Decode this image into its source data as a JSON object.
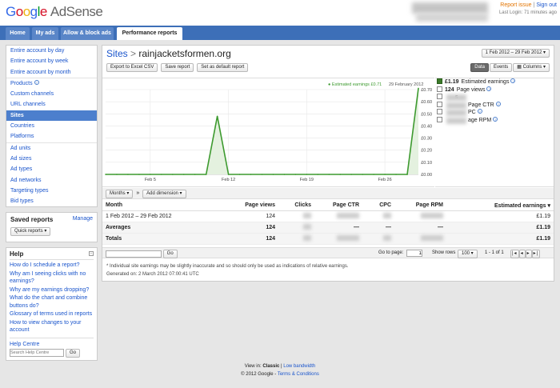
{
  "header": {
    "logo_parts": [
      "G",
      "o",
      "o",
      "g",
      "l",
      "e"
    ],
    "logo_product": "AdSense",
    "report_issue": "Report issue",
    "sign_out": "Sign out",
    "separator": "|",
    "last_login": "Last Login: 71 minutes ago"
  },
  "nav": {
    "tabs": [
      "Home",
      "My ads",
      "Allow & block ads",
      "Performance reports"
    ]
  },
  "sidebar": {
    "groups": [
      [
        "Entire account by day",
        "Entire account by week",
        "Entire account by month"
      ],
      [
        "Products",
        "Custom channels",
        "URL channels",
        "Sites",
        "Countries",
        "Platforms"
      ],
      [
        "Ad units",
        "Ad sizes",
        "Ad types",
        "Ad networks",
        "Targeting types",
        "Bid types"
      ]
    ],
    "selected": "Sites",
    "saved_title": "Saved reports",
    "manage": "Manage",
    "quick_reports": "Quick reports ▾",
    "help_title": "Help",
    "help_toggle": "−",
    "help_links": [
      "How do I schedule a report?",
      "Why am I seeing clicks with no earnings?",
      "Why are my earnings dropping?",
      "What do the chart and combine buttons do?",
      "Glossary of terms used in reports",
      "How to view changes to your account"
    ],
    "help_centre": "Help Centre",
    "help_search_placeholder": "Search Help Centre",
    "go": "Go"
  },
  "report": {
    "crumb": "Sites",
    "crumb_sep": ">",
    "site": "rainjacketsformen.org",
    "date_range": "1 Feb 2012 – 29 Feb 2012 ▾",
    "actions": [
      "Export to Excel CSV",
      "Save report",
      "Set as default report"
    ],
    "views": [
      "Data",
      "Events",
      "▦ Columns ▾"
    ],
    "tooltip_label": "● Estimated earnings £0.71",
    "tooltip_date": "29 February 2012",
    "metrics": [
      {
        "value": "£1.19",
        "label": "Estimated earnings",
        "checked": true
      },
      {
        "value": "124",
        "label": "Page views",
        "checked": false
      },
      {
        "value": "",
        "label": "s",
        "checked": false
      },
      {
        "value": "",
        "label": "Page CTR",
        "checked": false
      },
      {
        "value": "",
        "label": "PC",
        "checked": false
      },
      {
        "value": "",
        "label": "age RPM",
        "checked": false
      }
    ],
    "controls": {
      "months": "Months ▾",
      "arrow": "»",
      "add_dimension": "Add dimension ▾"
    },
    "columns": [
      "Month",
      "Page views",
      "Clicks",
      "Page CTR",
      "CPC",
      "Page RPM",
      "Estimated earnings ▾"
    ],
    "rows": [
      {
        "month": "1 Feb 2012 – 29 Feb 2012",
        "views": "124",
        "ctr": "",
        "cpc": "",
        "rpm": "",
        "earn": "£1.19"
      },
      {
        "month": "Averages",
        "views": "124",
        "ctr": "—",
        "cpc": "—",
        "rpm": "—",
        "earn": "£1.19"
      },
      {
        "month": "Totals",
        "views": "124",
        "ctr": "",
        "cpc": "",
        "rpm": "",
        "earn": "£1.19"
      }
    ],
    "pager": {
      "go": "Go",
      "go_to_page": "Go to page:",
      "page": "1",
      "show_rows": "Show rows",
      "rows": "100 ▾",
      "range": "1 - 1 of 1"
    },
    "note": "* Individual site earnings may be slightly inaccurate and so should only be used as indications of relative earnings.",
    "generated": "Generated on: 2 March 2012 07:00:41 UTC"
  },
  "chart_data": {
    "type": "line",
    "x_ticks": [
      "Feb 5",
      "Feb 12",
      "Feb 19",
      "Feb 26"
    ],
    "y_ticks": [
      "£0.70",
      "£0.60",
      "£0.50",
      "£0.40",
      "£0.30",
      "£0.20",
      "£0.10",
      "£0.00"
    ],
    "ylim": [
      0,
      0.7
    ],
    "series": [
      {
        "name": "Estimated earnings",
        "values": [
          0,
          0,
          0,
          0,
          0,
          0,
          0,
          0,
          0,
          0,
          0.48,
          0,
          0,
          0,
          0,
          0,
          0,
          0,
          0,
          0,
          0,
          0,
          0,
          0,
          0,
          0,
          0,
          0,
          0.71
        ]
      }
    ],
    "grid": true,
    "color": "#3d9a2f"
  },
  "footer": {
    "view_in": "View in:",
    "classic": "Classic",
    "sep": "|",
    "low_bandwidth": "Low bandwidth",
    "copyright": "© 2012 Google -",
    "terms": "Terms & Conditions"
  }
}
